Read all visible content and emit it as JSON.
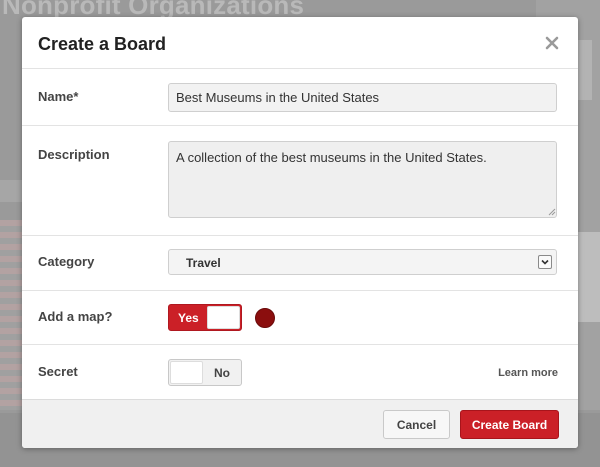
{
  "background": {
    "title": "Nonprofit Organizations"
  },
  "modal": {
    "title": "Create a Board",
    "close_icon": "close-icon",
    "name": {
      "label": "Name*",
      "value": "Best Museums in the United States"
    },
    "description": {
      "label": "Description",
      "value": "A collection of the best museums in the United States."
    },
    "category": {
      "label": "Category",
      "selected": "Travel",
      "arrow_icon": "chevron-down-icon"
    },
    "map": {
      "label": "Add a map?",
      "toggle_text": "Yes",
      "toggle_state": "on",
      "dot_color": "#8b0e0e"
    },
    "secret": {
      "label": "Secret",
      "toggle_text": "No",
      "toggle_state": "off",
      "learn_more": "Learn more"
    },
    "footer": {
      "cancel_label": "Cancel",
      "create_label": "Create Board"
    }
  },
  "colors": {
    "accent": "#cb2027",
    "overlay": "#9a9a9a"
  }
}
